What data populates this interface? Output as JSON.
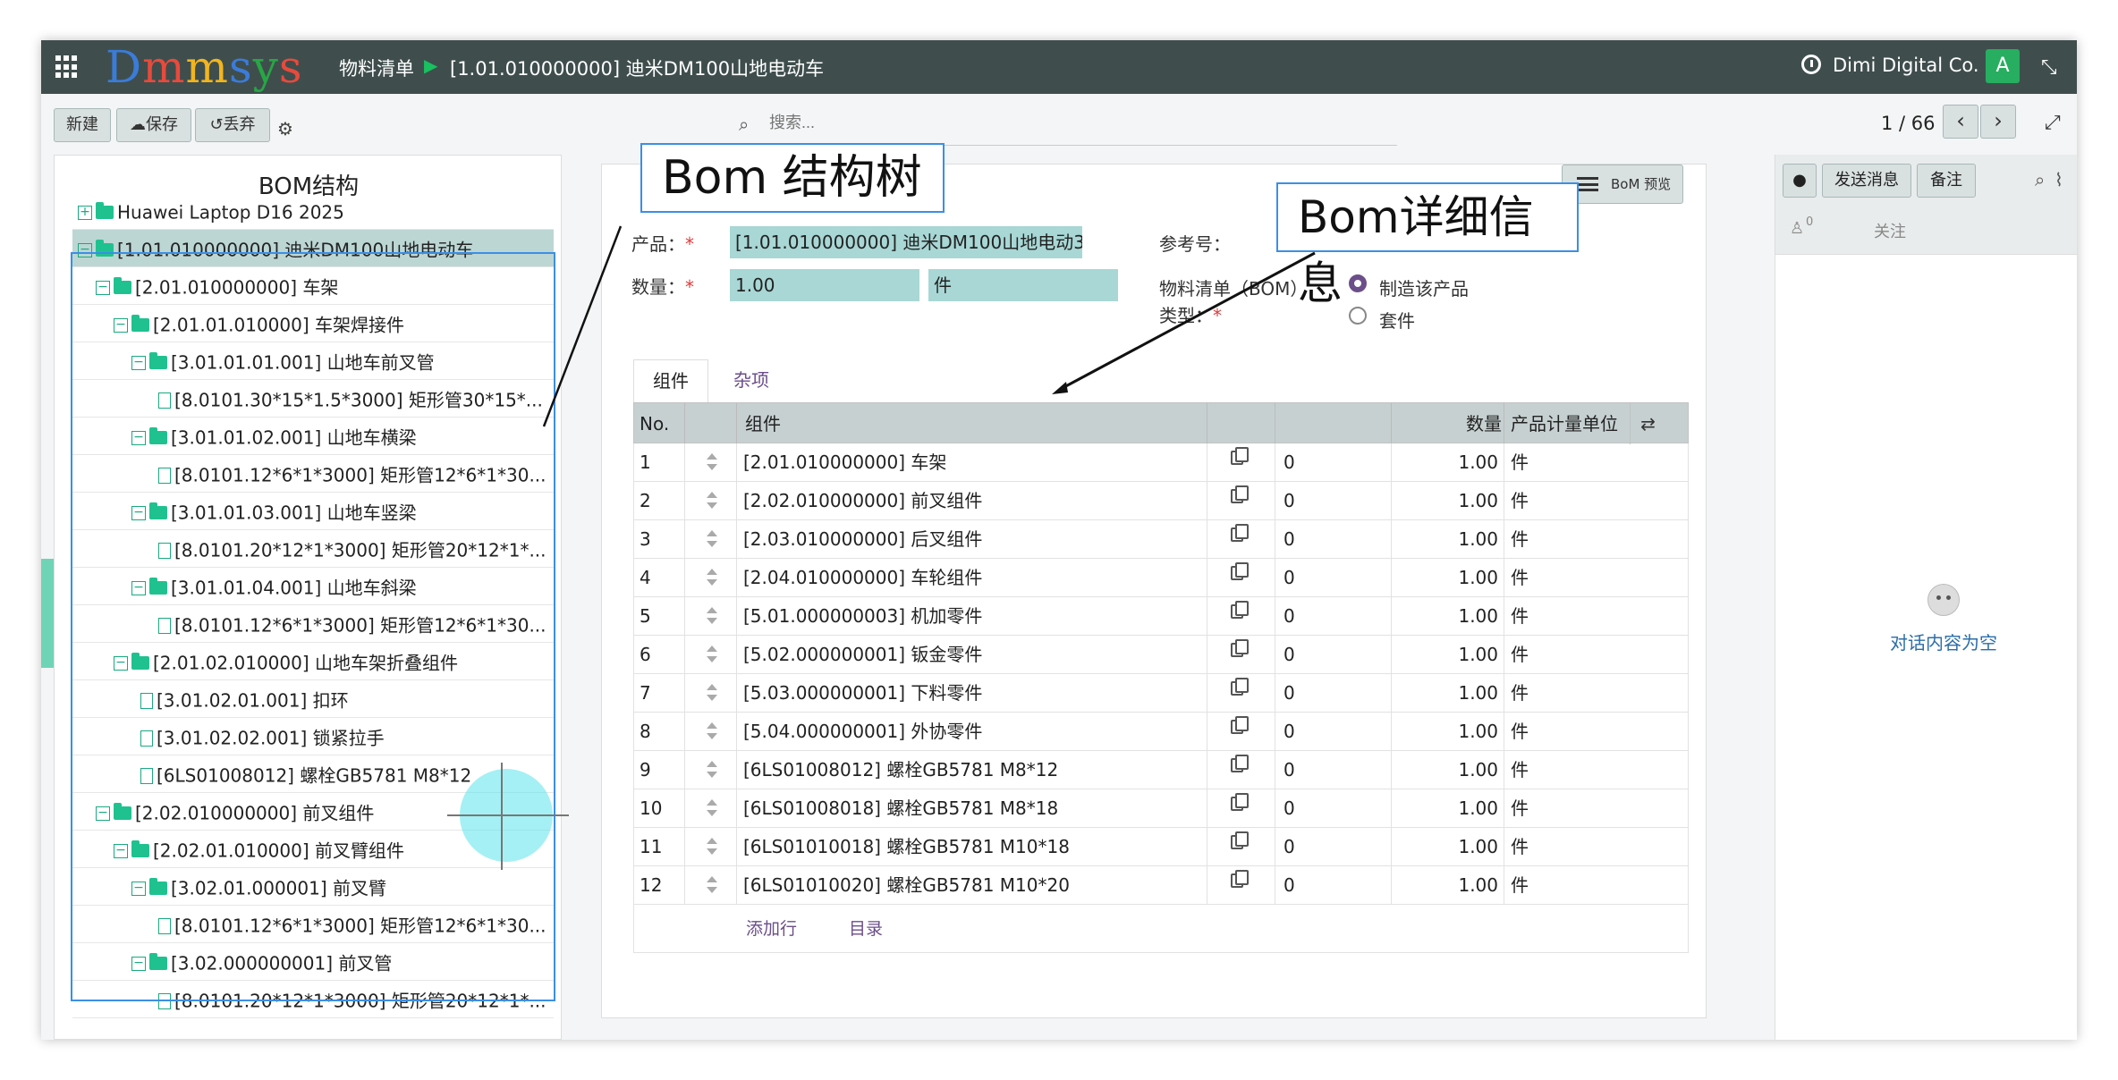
{
  "navbar": {
    "logo": "Dmmsys",
    "logo_colors": [
      "#3b7cd9",
      "#e84a3c",
      "#f2b51d",
      "#3b7cd9",
      "#27a744",
      "#e84a3c"
    ],
    "breadcrumb_root": "物料清单",
    "breadcrumb_sep": "▶",
    "breadcrumb_current": "[1.01.010000000] 迪米DM100山地电动车",
    "company": "Dimi Digital Co.",
    "avatar_letter": "A",
    "avatar_color": "#27ae60"
  },
  "control": {
    "new_label": "新建",
    "save_label": "保存",
    "discard_label": "丢弃",
    "search_placeholder": "搜索...",
    "pager": "1 / 66"
  },
  "bom_tree": {
    "title": "BOM结构",
    "nodes": [
      {
        "toggle": "+",
        "type": "folder",
        "label": "Huawei Laptop D16 2025"
      },
      {
        "toggle": "−",
        "type": "folder",
        "label": "[1.01.010000000] 迪米DM100山地电动车",
        "selected": true
      },
      {
        "toggle": "−",
        "type": "folder",
        "label": "[2.01.010000000] 车架"
      },
      {
        "toggle": "−",
        "type": "folder",
        "label": "[2.01.01.010000] 车架焊接件"
      },
      {
        "toggle": "−",
        "type": "folder",
        "label": "[3.01.01.01.001] 山地车前叉管"
      },
      {
        "toggle": "",
        "type": "file",
        "label": "[8.0101.30*15*1.5*3000] 矩形管30*15*..."
      },
      {
        "toggle": "−",
        "type": "folder",
        "label": "[3.01.01.02.001] 山地车横梁"
      },
      {
        "toggle": "",
        "type": "file",
        "label": "[8.0101.12*6*1*3000] 矩形管12*6*1*30..."
      },
      {
        "toggle": "−",
        "type": "folder",
        "label": "[3.01.01.03.001] 山地车竖梁"
      },
      {
        "toggle": "",
        "type": "file",
        "label": "[8.0101.20*12*1*3000] 矩形管20*12*1*..."
      },
      {
        "toggle": "−",
        "type": "folder",
        "label": "[3.01.01.04.001] 山地车斜梁"
      },
      {
        "toggle": "",
        "type": "file",
        "label": "[8.0101.12*6*1*3000] 矩形管12*6*1*30..."
      },
      {
        "toggle": "−",
        "type": "folder",
        "label": "[2.01.02.010000] 山地车架折叠组件"
      },
      {
        "toggle": "",
        "type": "file",
        "label": "[3.01.02.01.001] 扣环"
      },
      {
        "toggle": "",
        "type": "file",
        "label": "[3.01.02.02.001] 锁紧拉手"
      },
      {
        "toggle": "",
        "type": "file",
        "label": "[6LS01008012] 螺栓GB5781 M8*12"
      },
      {
        "toggle": "−",
        "type": "folder",
        "label": "[2.02.010000000] 前叉组件"
      },
      {
        "toggle": "−",
        "type": "folder",
        "label": "[2.02.01.010000] 前叉臂组件"
      },
      {
        "toggle": "−",
        "type": "folder",
        "label": "[3.02.01.000001] 前叉臂"
      },
      {
        "toggle": "",
        "type": "file",
        "label": "[8.0101.12*6*1*3000] 矩形管12*6*1*30..."
      },
      {
        "toggle": "−",
        "type": "folder",
        "label": "[3.02.000000001] 前叉管"
      },
      {
        "toggle": "",
        "type": "file",
        "label": "[8.0101.20*12*1*3000] 矩形管20*12*1*..."
      }
    ]
  },
  "annotations": {
    "tree_callout": "Bom 结构树",
    "detail_callout": "Bom详细信息"
  },
  "form": {
    "bom_preview_label": "BoM 预览",
    "product_label": "产品：",
    "product_value": "[1.01.010000000] 迪米DM100山地电动3",
    "qty_label": "数量：",
    "qty_value": "1.00",
    "uom_value": "件",
    "ref_label": "参考号：",
    "bom_type_label_1": "物料清单（BOM）",
    "bom_type_label_2": "类型：",
    "type_options": [
      "制造该产品",
      "套件"
    ],
    "required_mark": "*",
    "tabs": [
      "组件",
      "杂项"
    ],
    "columns": {
      "no": "No.",
      "component": "组件",
      "qty": "数量",
      "uom": "产品计量单位"
    },
    "rows": [
      {
        "no": "1",
        "component": "[2.01.010000000] 车架",
        "extra": "0",
        "qty": "1.00",
        "uom": "件"
      },
      {
        "no": "2",
        "component": "[2.02.010000000] 前叉组件",
        "extra": "0",
        "qty": "1.00",
        "uom": "件"
      },
      {
        "no": "3",
        "component": "[2.03.010000000] 后叉组件",
        "extra": "0",
        "qty": "1.00",
        "uom": "件"
      },
      {
        "no": "4",
        "component": "[2.04.010000000] 车轮组件",
        "extra": "0",
        "qty": "1.00",
        "uom": "件"
      },
      {
        "no": "5",
        "component": "[5.01.000000003] 机加零件",
        "extra": "0",
        "qty": "1.00",
        "uom": "件"
      },
      {
        "no": "6",
        "component": "[5.02.000000001] 钣金零件",
        "extra": "0",
        "qty": "1.00",
        "uom": "件"
      },
      {
        "no": "7",
        "component": "[5.03.000000001] 下料零件",
        "extra": "0",
        "qty": "1.00",
        "uom": "件"
      },
      {
        "no": "8",
        "component": "[5.04.000000001] 外协零件",
        "extra": "0",
        "qty": "1.00",
        "uom": "件"
      },
      {
        "no": "9",
        "component": "[6LS01008012] 螺栓GB5781 M8*12",
        "extra": "0",
        "qty": "1.00",
        "uom": "件"
      },
      {
        "no": "10",
        "component": "[6LS01008018] 螺栓GB5781 M8*18",
        "extra": "0",
        "qty": "1.00",
        "uom": "件"
      },
      {
        "no": "11",
        "component": "[6LS01010018] 螺栓GB5781 M10*18",
        "extra": "0",
        "qty": "1.00",
        "uom": "件"
      },
      {
        "no": "12",
        "component": "[6LS01010020] 螺栓GB5781 M10*20",
        "extra": "0",
        "qty": "1.00",
        "uom": "件"
      }
    ],
    "add_row_label": "添加行",
    "catalog_label": "目录"
  },
  "chatter": {
    "send_message_label": "发送消息",
    "note_label": "备注",
    "follower_count": "0",
    "follow_label": "关注",
    "empty_text": "对话内容为空"
  },
  "colors": {
    "navbar": "#3f4e4d",
    "accent": "#6b4e8a",
    "field_bg": "#a8d7d5",
    "tree_icon": "#1fc28f",
    "highlight_border": "#3b8fe5"
  }
}
